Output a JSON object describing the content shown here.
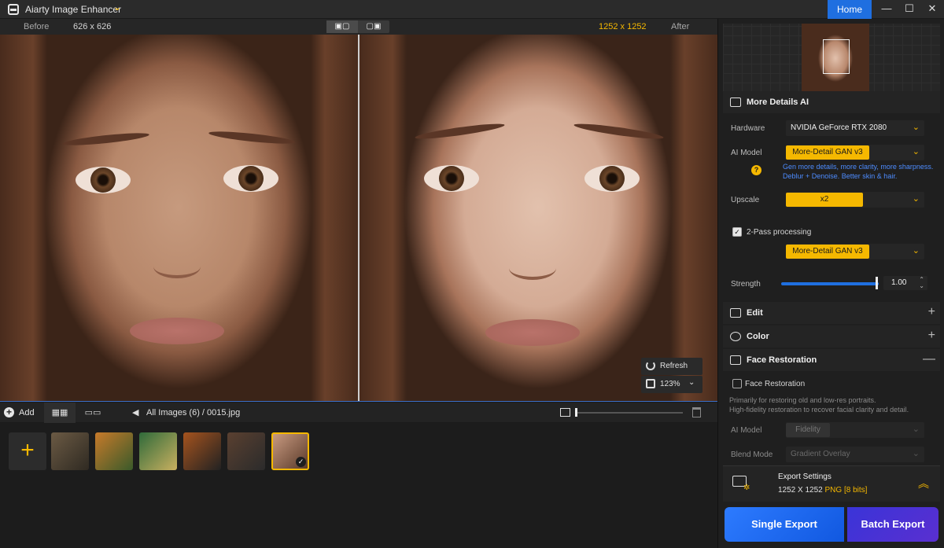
{
  "titlebar": {
    "app_title": "Aiarty Image Enhancer",
    "home_label": "Home",
    "minimize": "—",
    "maximize": "☐",
    "close": "✕"
  },
  "compare": {
    "before_label": "Before",
    "before_size": "626 x 626",
    "after_size": "1252 x 1252",
    "after_label": "After"
  },
  "viewer": {
    "refresh_label": "Refresh",
    "zoom_value": "123%"
  },
  "bottom_bar": {
    "add_label": "Add",
    "breadcrumb": "All Images (6)  /   0015.jpg"
  },
  "thumbnails": [
    {
      "name": "butterfly",
      "colors": [
        "#6b5a44",
        "#2f2a22"
      ]
    },
    {
      "name": "tiger",
      "colors": [
        "#c77a2a",
        "#3a5a2a"
      ]
    },
    {
      "name": "fairy-jar",
      "colors": [
        "#2f6a3a",
        "#c9b060"
      ]
    },
    {
      "name": "burger",
      "colors": [
        "#a5531e",
        "#222"
      ]
    },
    {
      "name": "steampunk-dog",
      "colors": [
        "#5a4030",
        "#2b2b2b"
      ]
    },
    {
      "name": "portrait",
      "colors": [
        "#c89a80",
        "#5a3a2a"
      ],
      "selected": true
    }
  ],
  "panel": {
    "section_title": "More Details AI",
    "hardware_label": "Hardware",
    "hardware_value": "NVIDIA GeForce RTX 2080",
    "ai_model_label": "AI Model",
    "ai_model_value": "More-Detail GAN  v3",
    "model_desc": "Gen more details, more clarity, more sharpness. Deblur + Denoise. Better skin & hair.",
    "upscale_label": "Upscale",
    "upscale_value": "x2",
    "two_pass_label": "2-Pass processing",
    "two_pass_checked": true,
    "two_pass_model": "More-Detail GAN  v3",
    "strength_label": "Strength",
    "strength_value": "1.00",
    "edit_label": "Edit",
    "color_label": "Color",
    "face_restoration_label": "Face Restoration",
    "face_restoration_checkbox": "Face Restoration",
    "face_desc_1": "Primarily for restoring old and low-res portraits.",
    "face_desc_2": "High-fidelity restoration to recover facial clarity and detail.",
    "fr_model_label": "AI Model",
    "fr_model_value": "Fidelity",
    "blend_label": "Blend Mode",
    "blend_value": "Gradient Overlay"
  },
  "export": {
    "title": "Export Settings",
    "dims": "1252 X 1252",
    "format": "PNG",
    "bits": "[8 bits]",
    "single_label": "Single Export",
    "batch_label": "Batch Export"
  }
}
